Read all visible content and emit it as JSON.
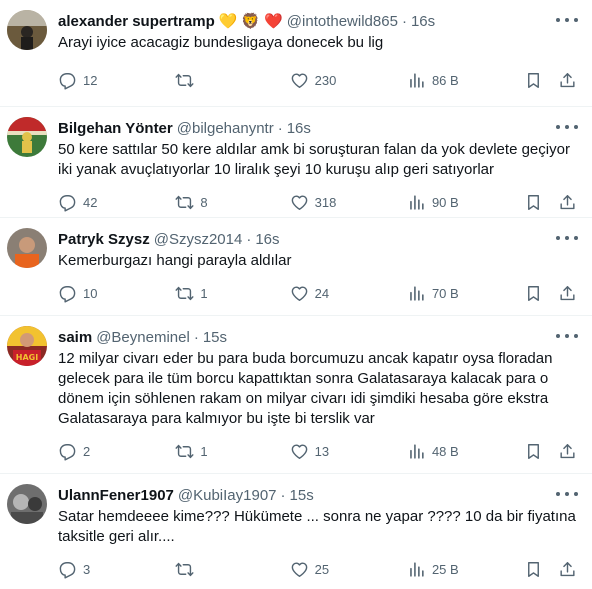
{
  "tweets": [
    {
      "name": "alexander supertramp",
      "badges": [
        "💛",
        "🦁",
        "❤️"
      ],
      "handle": "@intothewild865",
      "time": "16s",
      "text": "Arayi iyice acacagiz bundesligaya donecek bu lig",
      "replies": "12",
      "retweets": "",
      "likes": "230",
      "views": "86 B",
      "avatar": "photo-landscape-person"
    },
    {
      "name": "Bilgehan Yönter",
      "badges": [],
      "handle": "@bilgehanyntr",
      "time": "16s",
      "text": "50 kere sattılar 50 kere aldılar amk bi soruşturan falan da yok devlete geçiyor iki yanak avuçlatıyorlar 10 liralık şeyi 10 kuruşu alıp geri satıyorlar",
      "replies": "42",
      "retweets": "8",
      "likes": "318",
      "views": "90 B",
      "avatar": "photo-stadium-player"
    },
    {
      "name": "Patryk Szysz",
      "badges": [],
      "handle": "@Szysz2014",
      "time": "16s",
      "text": "Kemerburgazı hangi parayla aldılar",
      "replies": "10",
      "retweets": "1",
      "likes": "24",
      "views": "70 B",
      "avatar": "photo-player-orange-kit"
    },
    {
      "name": "saim",
      "badges": [],
      "handle": "@Beyneminel",
      "time": "15s",
      "text": "12 milyar civarı eder bu para buda borcumuzu ancak kapatır oysa floradan gelecek para ile tüm borcu kapattıktan sonra Galatasaraya kalacak para o dönem için söhlenen rakam on milyar civarı idi şimdiki hesaba göre ekstra Galatasaraya para kalmıyor bu işte bi terslik var",
      "replies": "2",
      "retweets": "1",
      "likes": "13",
      "views": "48 B",
      "avatar": "photo-hagi-red-yellow"
    },
    {
      "name": "UlannFener1907",
      "badges": [],
      "handle": "@KubiIay1907",
      "time": "15s",
      "text": "Satar hemdeeee kime??? Hükümete ... sonra ne yapar ???? 10 da bir fiyatına taksitle geri alır....",
      "replies": "3",
      "retweets": "",
      "likes": "25",
      "views": "25 B",
      "avatar": "photo-grayscale-portrait"
    }
  ],
  "icons": {
    "reply": "reply-icon",
    "retweet": "retweet-icon",
    "like": "heart-icon",
    "views": "views-icon",
    "bookmark": "bookmark-icon",
    "share": "share-icon",
    "more": "more-icon"
  },
  "colors": {
    "text": "#0f1419",
    "muted": "#536471",
    "divider": "#eff3f4"
  }
}
